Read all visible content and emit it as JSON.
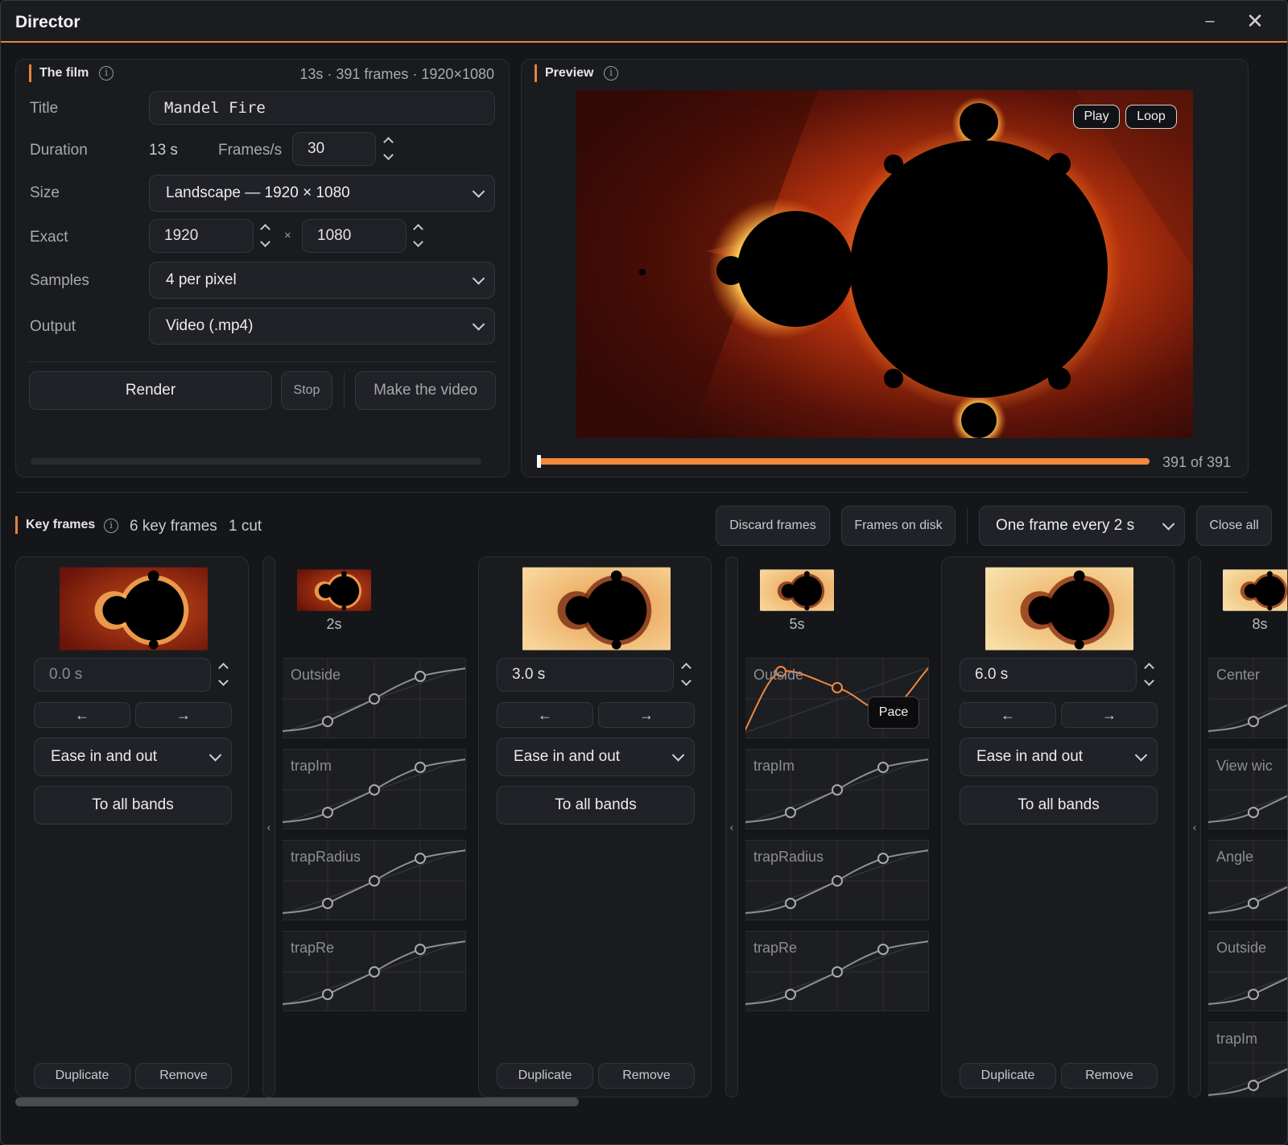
{
  "window": {
    "title": "Director",
    "minimize_glyph": "–",
    "close_glyph": "✕"
  },
  "film": {
    "section_title": "The film",
    "summary": "13s · 391 frames · 1920×1080",
    "title_label": "Title",
    "title_value": "Mandel Fire",
    "duration_label": "Duration",
    "duration_value": "13 s",
    "fps_label": "Frames/s",
    "fps_value": "30",
    "size_label": "Size",
    "size_value": "Landscape — 1920 × 1080",
    "exact_label": "Exact",
    "exact_width": "1920",
    "exact_x": "×",
    "exact_height": "1080",
    "samples_label": "Samples",
    "samples_value": "4 per pixel",
    "output_label": "Output",
    "output_value": "Video (.mp4)",
    "render_label": "Render",
    "stop_label": "Stop",
    "make_video_label": "Make the video",
    "render_progress": 0
  },
  "preview": {
    "section_title": "Preview",
    "play_label": "Play",
    "loop_label": "Loop",
    "frame_counter": "391 of 391",
    "progress": 1.0
  },
  "keyframes": {
    "section_title": "Key frames",
    "count_text": "6 key frames",
    "cut_text": "1 cut",
    "discard_label": "Discard frames",
    "on_disk_label": "Frames on disk",
    "interval_value": "One frame every 2 s",
    "close_all_label": "Close all",
    "cards": [
      {
        "time": "0.0 s",
        "easing": "Ease in and out",
        "to_all": "To all bands",
        "duplicate": "Duplicate",
        "remove": "Remove",
        "prev": "←",
        "next": "→"
      },
      {
        "time": "3.0 s",
        "easing": "Ease in and out",
        "to_all": "To all bands",
        "duplicate": "Duplicate",
        "remove": "Remove",
        "prev": "←",
        "next": "→"
      },
      {
        "time": "6.0 s",
        "easing": "Ease in and out",
        "to_all": "To all bands",
        "duplicate": "Duplicate",
        "remove": "Remove",
        "prev": "←",
        "next": "→"
      }
    ],
    "transitions": [
      {
        "time": "2s",
        "bands": [
          "Outside",
          "trapIm",
          "trapRadius",
          "trapRe"
        ]
      },
      {
        "time": "5s",
        "bands": [
          "Outside",
          "trapIm",
          "trapRadius",
          "trapRe"
        ],
        "tooltip": "Pace"
      },
      {
        "time": "8s",
        "bands": [
          "Center",
          "View wic",
          "Angle",
          "Outside",
          "trapIm"
        ]
      }
    ],
    "separator_glyph": "‹"
  },
  "colors": {
    "accent": "#f0883e",
    "background": "#15161a",
    "panel": "#1a1b1f"
  }
}
